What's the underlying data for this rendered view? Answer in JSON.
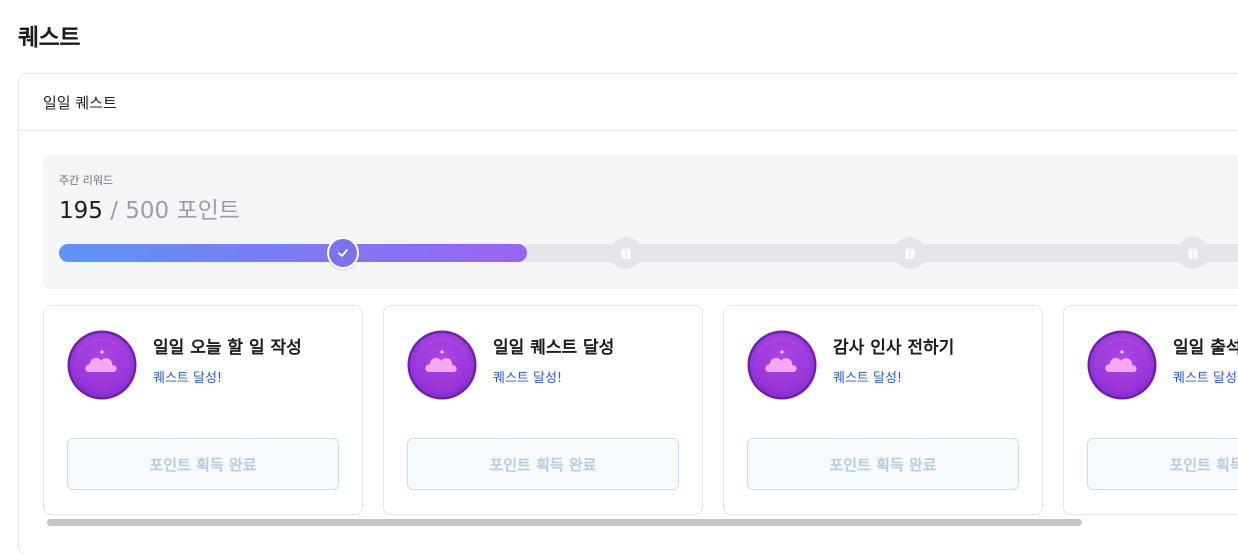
{
  "page": {
    "title": "퀘스트"
  },
  "panel": {
    "title": "일일 퀘스트"
  },
  "weekly_reward": {
    "label": "주간 리워드",
    "current": "195",
    "total": "/ 500 포인트",
    "progress_fraction": 0.39,
    "milestones": [
      {
        "status": "done",
        "icon": "check-icon"
      },
      {
        "status": "locked",
        "icon": "gift-icon"
      },
      {
        "status": "locked",
        "icon": "gift-icon"
      },
      {
        "status": "locked",
        "icon": "gift-icon"
      }
    ],
    "colors": {
      "fill_start": "#5c94f7",
      "fill_end": "#9b63f3",
      "track": "#e4e5ea"
    }
  },
  "quests": [
    {
      "title": "일일 오늘 할 일 작성",
      "status": "퀘스트 달성!",
      "button": "포인트 획득 완료",
      "icon": "cloud-badge-icon"
    },
    {
      "title": "일일 퀘스트 달성",
      "status": "퀘스트 달성!",
      "button": "포인트 획득 완료",
      "icon": "cloud-badge-icon"
    },
    {
      "title": "감사 인사 전하기",
      "status": "퀘스트 달성!",
      "button": "포인트 획득 완료",
      "icon": "cloud-badge-icon"
    },
    {
      "title": "일일 출석",
      "status": "퀘스트 달성!",
      "button": "포인트 획득 완료",
      "icon": "cloud-badge-icon"
    }
  ]
}
